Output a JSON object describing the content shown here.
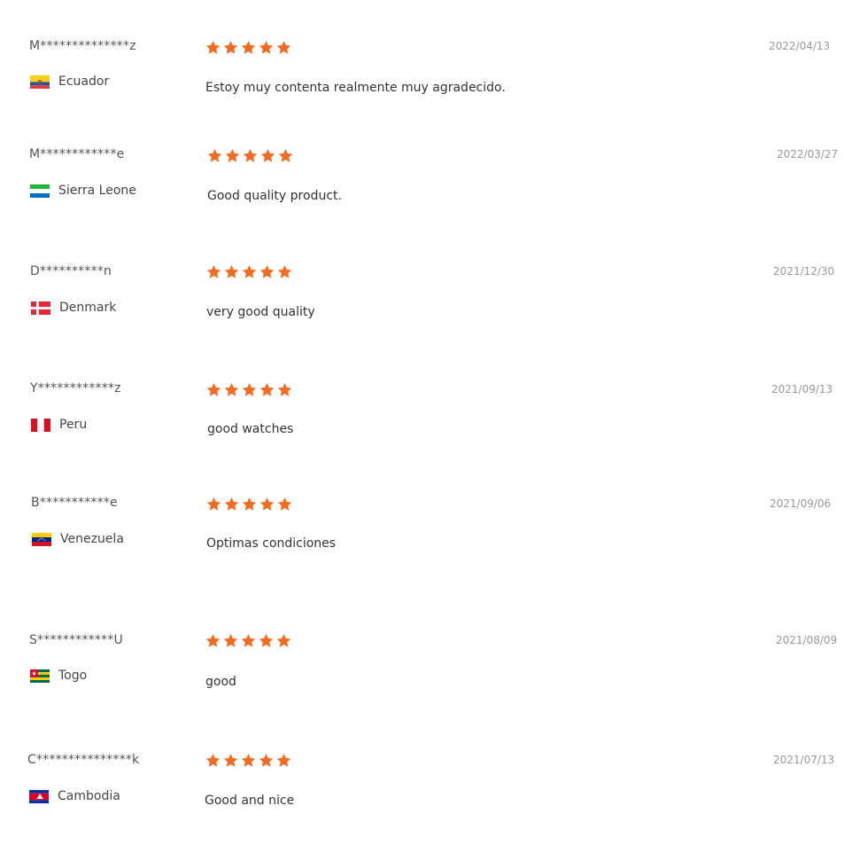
{
  "colors": {
    "star": "#f26b21",
    "date": "#999999",
    "text": "#333333"
  },
  "reviews": [
    {
      "user": "M**************z",
      "country": "Ecuador",
      "flag": "flag-ecuador",
      "rating": 5,
      "comment": "Estoy muy contenta realmente muy agradecido.",
      "date": "2022/04/13"
    },
    {
      "user": "M************e",
      "country": "Sierra Leone",
      "flag": "flag-sierra-leone",
      "rating": 5,
      "comment": "Good quality product.",
      "date": "2022/03/27"
    },
    {
      "user": "D**********n",
      "country": "Denmark",
      "flag": "flag-denmark",
      "rating": 5,
      "comment": "very good quality",
      "date": "2021/12/30"
    },
    {
      "user": "Y************z",
      "country": "Peru",
      "flag": "flag-peru",
      "rating": 5,
      "comment": "good watches",
      "date": "2021/09/13"
    },
    {
      "user": "B***********e",
      "country": "Venezuela",
      "flag": "flag-venezuela",
      "rating": 5,
      "comment": "Optimas condiciones",
      "date": "2021/09/06"
    },
    {
      "user": "S************U",
      "country": "Togo",
      "flag": "flag-togo",
      "rating": 5,
      "comment": "good",
      "date": "2021/08/09"
    },
    {
      "user": "C***************k",
      "country": "Cambodia",
      "flag": "flag-cambodia",
      "rating": 5,
      "comment": "Good and nice",
      "date": "2021/07/13"
    }
  ]
}
